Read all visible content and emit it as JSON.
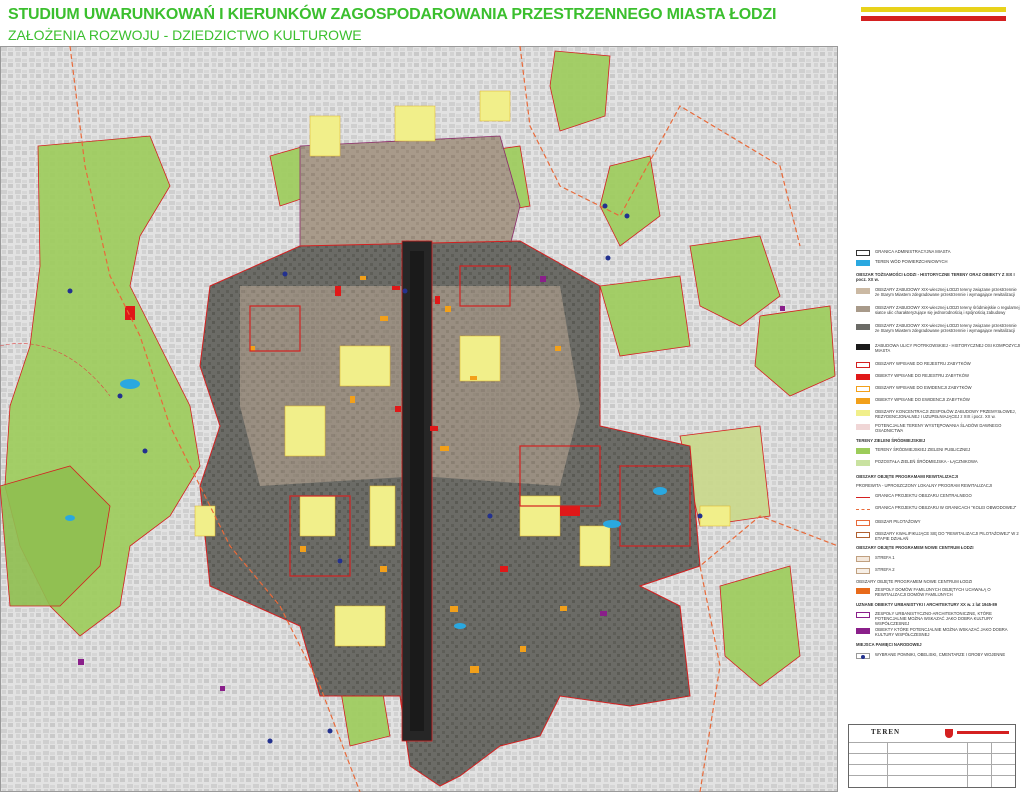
{
  "title": "STUDIUM UWARUNKOWAŃ I KIERUNKÓW ZAGOSPODAROWANIA PRZESTRZENNEGO MIASTA ŁODZI",
  "subtitle": "ZAŁOŻENIA ROZWOJU - DZIEDZICTWO KULTUROWE",
  "flag_colors": [
    "#e8d21a",
    "#ffffff",
    "#d42020"
  ],
  "colors": {
    "title_green": "#3bbf2e",
    "historic_zone": "#5a5a55",
    "green_areas": "#9ccc5a",
    "register_outline": "#d42020",
    "monuments_register": "#e01818",
    "monuments_evidence": "#f2a01a",
    "industrial": "#f1ef8a",
    "city_fabric": "#e4e4e4",
    "water": "#2aa8e0",
    "memory_sites": "#23318f"
  },
  "legend": {
    "admin_boundary": "GRANICA ADMINISTRACYJNA MIASTA",
    "water": "TEREN WÓD POWIERZCHNIOWYCH",
    "section_identity": "OBSZAR TOŻSAMOŚCI ŁODZI - HISTORYCZNE TERENY ORAZ OBIEKTY Z XIX I pocz. XX w.",
    "zone1": "OBSZARY ZABUDOWY XIX-wiecznej ŁODZI tereny związane przestrzennie ze Starym Miastem zdegradowane przestrzennie i wymagające rewitalizacji",
    "zone2": "OBSZARY ZABUDOWY XIX-wiecznej ŁODZI tereny śródmiejskie o regularnej siatce ulic charakteryzujące się jednorodnością i spójnością zabudowy",
    "zone3": "OBSZARY ZABUDOWY XIX-wiecznej ŁODZI tereny związane przestrzennie ze Starym Miastem zdegradowane przestrzennie i wymagające rewitalizacji",
    "piotrkowska": "ZABUDOWA ULICY PIOTRKOWSKIEJ - HISTORYCZNEJ OSI KOMPOZYCJI MIASTA",
    "register_areas": "OBSZARY WPISANE DO REJESTRU ZABYTKÓW",
    "register_objects": "OBIEKTY WPISANE DO REJESTRU ZABYTKÓW",
    "evidence_areas": "OBSZARY WPISANE DO EWIDENCJI ZABYTKÓW",
    "evidence_objects": "OBIEKTY WPISANE DO EWIDENCJI ZABYTKÓW",
    "industrial": "OBSZARY KONCENTRACJI ZESPOŁÓW ZABUDOWY PRZEMYSŁOWEJ, REZYDENCJONALNEJ I UZUPEŁNIAJĄCEJ z XIX i pocz. XX w.",
    "former_settlement": "POTENCJALNE TERENY WYSTĘPOWANIA ŚLADÓW DAWNEGO OSADNICTWA",
    "section_green": "TERENY ZIELENI ŚRÓDMIEJSKIEJ",
    "public_green": "TERENY ŚRÓDMIEJSKIEJ ZIELENI PUBLICZNEJ",
    "meadow_green": "POZOSTAŁA ZIELEŃ ŚRÓDMIEJSKA - ŁĄCZNIKOWA",
    "section_revital": "OBSZARY OBJĘTE PROGRAMAMI REWITALIZACJI",
    "revital_programme": "PROREWITA - UPROSZCZONY LOKALNY PROGRAM REWITALIZACJI",
    "central_boundary": "GRANICA PROJEKTU OBSZARU CENTRALNEGO",
    "ring_rail": "GRANICA PROJEKTU OBSZARU W GRANICACH \"KOLEI OBWODOWEJ\"",
    "pilot_area": "OBSZAR PILOTAŻOWY",
    "pilot_stage2": "OBSZARY KWALIFIKUJĄCE SIĘ DO \"REWITALIZACJI PILOTAŻOWEJ\" W 2 ETAPIE DZIAŁAŃ",
    "new_centre": "OBSZARY OBJĘTE PROGRAMEM NOWE CENTRUM ŁODZI",
    "zone_1": "STREFA 1",
    "zone_2": "STREFA 2",
    "new_centre2": "OBSZARY OBJĘTE PROGRAMEM NOWE CENTRUM ŁODZI",
    "family_houses": "ZESPOŁY DOMÓW FAMILIJNYCH OBJĘTYCH UCHWAŁĄ O REWITALIZACJI DOMÓW FAMILIJNYCH",
    "section_modern": "UZNANE OBIEKTY URBANISTYKI I ARCHITEKTURY XX w. z lat 1945-89",
    "modern_complexes": "ZESPOŁY URBANISTYCZNO-ARCHITEKTONICZNE, KTÓRE POTENCJALNIE MOŻNA WSKAZAĆ JAKO DOBRA KULTURY WSPÓŁCZESNEJ",
    "modern_objects": "OBIEKTY KTÓRE POTENCJALNIE MOŻNA WSKAZAĆ JAKO DOBRA KULTURY WSPÓŁCZESNEJ",
    "section_memory": "MIEJSCA PAMIĘCI NARODOWEJ",
    "memory_sites": "WYBRANE POMNIKI, OBELISKI, CMENTARZE I GROBY WOJENNE"
  },
  "titleblock": {
    "logo": "TEREN"
  }
}
